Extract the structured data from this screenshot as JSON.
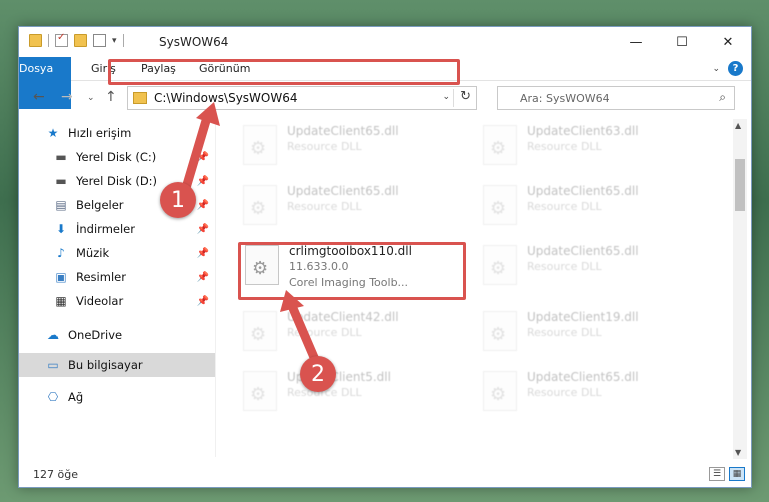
{
  "window": {
    "title": "SysWOW64"
  },
  "ribbon": {
    "tabs": [
      "Dosya",
      "Giriş",
      "Paylaş",
      "Görünüm"
    ]
  },
  "address": {
    "path": "C:\\Windows\\SysWOW64"
  },
  "search": {
    "placeholder": "Ara: SysWOW64"
  },
  "sidebar": {
    "items": [
      {
        "label": "Hızlı erişim",
        "icon": "star-icon"
      },
      {
        "label": "Yerel Disk (C:)",
        "icon": "drive-icon"
      },
      {
        "label": "Yerel Disk (D:)",
        "icon": "drive-icon"
      },
      {
        "label": "Belgeler",
        "icon": "documents-icon"
      },
      {
        "label": "İndirmeler",
        "icon": "download-icon"
      },
      {
        "label": "Müzik",
        "icon": "music-icon"
      },
      {
        "label": "Resimler",
        "icon": "pictures-icon"
      },
      {
        "label": "Videolar",
        "icon": "video-icon"
      },
      {
        "label": "OneDrive",
        "icon": "cloud-icon"
      },
      {
        "label": "Bu bilgisayar",
        "icon": "computer-icon"
      },
      {
        "label": "Ağ",
        "icon": "network-icon"
      }
    ]
  },
  "files": [
    {
      "name": "UpdateClient65.dll",
      "sub": "Resource DLL"
    },
    {
      "name": "UpdateClient63.dll",
      "sub": "Resource DLL"
    },
    {
      "name": "UpdateClient65.dll",
      "sub": "Resource DLL"
    },
    {
      "name": "UpdateClient65.dll",
      "sub": "Resource DLL"
    },
    {
      "name": "crlimgtoolbox110.dll",
      "sub": "11.633.0.0",
      "sub2": "Corel Imaging Toolb..."
    },
    {
      "name": "UpdateClient65.dll",
      "sub": "Resource DLL"
    },
    {
      "name": "UpdateClient42.dll",
      "sub": "Resource DLL"
    },
    {
      "name": "UpdateClient19.dll",
      "sub": "Resource DLL"
    },
    {
      "name": "UpdateClient5.dll",
      "sub": "Resource DLL"
    },
    {
      "name": "UpdateClient65.dll",
      "sub": "Resource DLL"
    }
  ],
  "status": {
    "count": "127 öğe"
  },
  "callouts": [
    "1",
    "2"
  ],
  "colors": {
    "accent": "#1979ca",
    "highlight": "#d9534f"
  }
}
